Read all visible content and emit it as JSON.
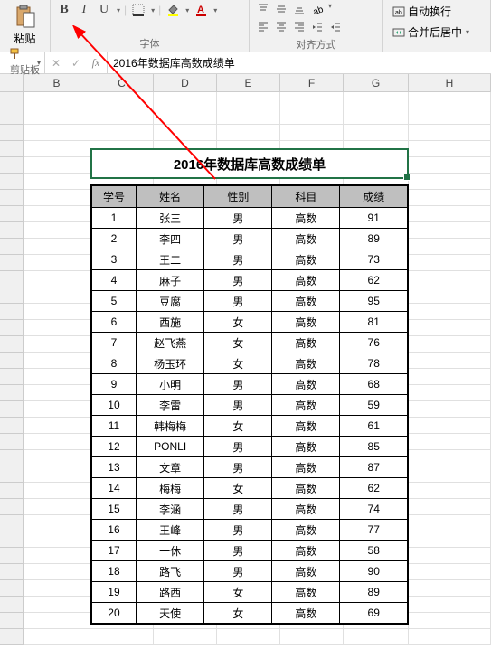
{
  "ribbon": {
    "paste_label": "粘贴",
    "clipboard_label": "剪贴板",
    "font_label": "字体",
    "align_label": "对齐方式",
    "bold": "B",
    "italic": "I",
    "underline": "U",
    "wrap_text": "自动换行",
    "merge_center": "合并后居中"
  },
  "formula_bar": {
    "fx": "fx",
    "content": "2016年数据库高数成绩单"
  },
  "columns": [
    "B",
    "C",
    "D",
    "E",
    "F",
    "G",
    "H"
  ],
  "title": "2016年数据库高数成绩单",
  "headers": [
    "学号",
    "姓名",
    "性别",
    "科目",
    "成绩"
  ],
  "chart_data": {
    "type": "table",
    "columns": [
      "学号",
      "姓名",
      "性别",
      "科目",
      "成绩"
    ],
    "rows": [
      [
        "1",
        "张三",
        "男",
        "高数",
        "91"
      ],
      [
        "2",
        "李四",
        "男",
        "高数",
        "89"
      ],
      [
        "3",
        "王二",
        "男",
        "高数",
        "73"
      ],
      [
        "4",
        "麻子",
        "男",
        "高数",
        "62"
      ],
      [
        "5",
        "豆腐",
        "男",
        "高数",
        "95"
      ],
      [
        "6",
        "西施",
        "女",
        "高数",
        "81"
      ],
      [
        "7",
        "赵飞燕",
        "女",
        "高数",
        "76"
      ],
      [
        "8",
        "杨玉环",
        "女",
        "高数",
        "78"
      ],
      [
        "9",
        "小明",
        "男",
        "高数",
        "68"
      ],
      [
        "10",
        "李雷",
        "男",
        "高数",
        "59"
      ],
      [
        "11",
        "韩梅梅",
        "女",
        "高数",
        "61"
      ],
      [
        "12",
        "PONLI",
        "男",
        "高数",
        "85"
      ],
      [
        "13",
        "文章",
        "男",
        "高数",
        "87"
      ],
      [
        "14",
        "梅梅",
        "女",
        "高数",
        "62"
      ],
      [
        "15",
        "李涵",
        "男",
        "高数",
        "74"
      ],
      [
        "16",
        "王峰",
        "男",
        "高数",
        "77"
      ],
      [
        "17",
        "一休",
        "男",
        "高数",
        "58"
      ],
      [
        "18",
        "路飞",
        "男",
        "高数",
        "90"
      ],
      [
        "19",
        "路西",
        "女",
        "高数",
        "89"
      ],
      [
        "20",
        "天使",
        "女",
        "高数",
        "69"
      ]
    ]
  }
}
